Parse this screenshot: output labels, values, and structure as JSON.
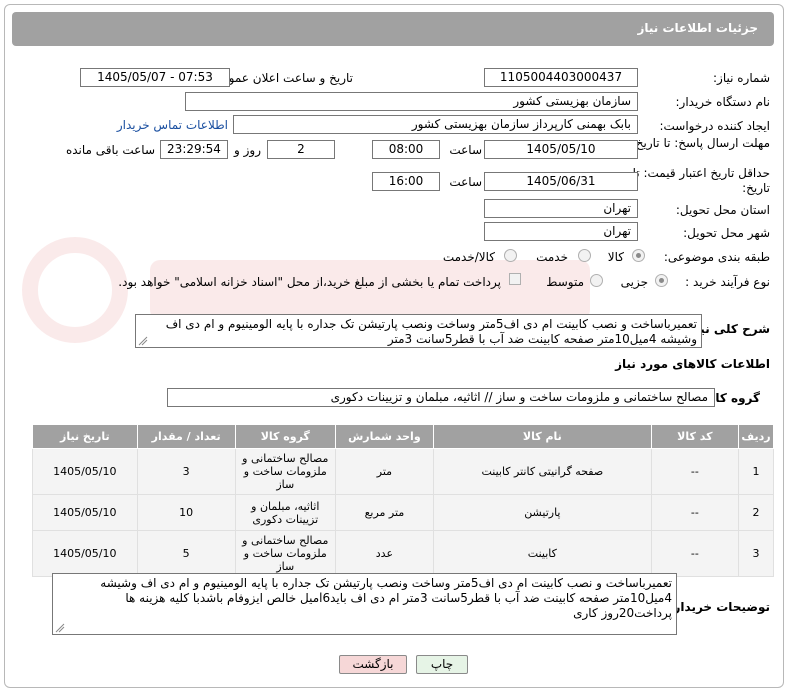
{
  "header": {
    "title": "جزئیات اطلاعات نیاز"
  },
  "fields": {
    "need_number_label": "شماره نیاز:",
    "need_number": "1105004403000437",
    "announce_label": "تاریخ و ساعت اعلان عمومی:",
    "announce_value": "1405/05/07 - 07:53",
    "buyer_org_label": "نام دستگاه خریدار:",
    "buyer_org": "سازمان بهزیستی کشور",
    "creator_label": "ایجاد کننده درخواست:",
    "creator": "بابک بهمنی کارپرداز سازمان بهزیستی کشور",
    "contact_link": "اطلاعات تماس خریدار",
    "send_deadline_label": "مهلت ارسال پاسخ: تا تاریخ:",
    "send_date": "1405/05/10",
    "time_label": "ساعت",
    "send_time": "08:00",
    "days": "2",
    "days_label": "روز و",
    "remaining": "23:29:54",
    "remaining_label": "ساعت باقی مانده",
    "price_validity_label": "حداقل تاریخ اعتبار قیمت: تا تاریخ:",
    "validity_date": "1405/06/31",
    "validity_time": "16:00",
    "province_label": "استان محل تحویل:",
    "province": "تهران",
    "city_label": "شهر محل تحویل:",
    "city": "تهران",
    "category_label": "طبقه بندی موضوعی:",
    "category_options": [
      "کالا",
      "خدمت",
      "کالا/خدمت"
    ],
    "process_label": "نوع فرآیند خرید :",
    "process_options": [
      "جزیی",
      "متوسط"
    ],
    "payment_note": "پرداخت تمام یا بخشی از مبلغ خرید،از محل \"اسناد خزانه اسلامی\" خواهد بود."
  },
  "description": {
    "label": "شرح کلی نیاز:",
    "text": "تعمیرباساخت و نصب کابینت ام دی اف5متر وساخت ونصب پارتیشن تک جداره با پایه الومینیوم و ام دی اف وشیشه 4میل10متر صفحه کابینت ضد آب با قطر5سانت 3متر"
  },
  "goods_section": {
    "title": "اطلاعات کالاهای مورد نیاز",
    "group_label": "گروه کالا:",
    "group_value": "مصالح ساختمانی و ملزومات ساخت و ساز // اثاثیه، مبلمان و تزیینات دکوری"
  },
  "table": {
    "headers": [
      "ردیف",
      "کد کالا",
      "نام کالا",
      "واحد شمارش",
      "گروه کالا",
      "تعداد / مقدار",
      "تاریخ نیاز"
    ],
    "rows": [
      [
        "1",
        "--",
        "صفحه گرانیتی کانتر کابینت",
        "متر",
        "مصالح ساختمانی و ملزومات ساخت و ساز",
        "3",
        "1405/05/10"
      ],
      [
        "2",
        "--",
        "پارتیشن",
        "متر مربع",
        "اثاثیه، مبلمان و تزیینات دکوری",
        "10",
        "1405/05/10"
      ],
      [
        "3",
        "--",
        "کابینت",
        "عدد",
        "مصالح ساختمانی و ملزومات ساخت و ساز",
        "5",
        "1405/05/10"
      ]
    ]
  },
  "buyer_notes": {
    "label": "توضیحات خریدار:",
    "text": "تعمیرباساخت و نصب کابینت ام دی اف5متر وساخت ونصب پارتیشن تک جداره با پایه الومینیوم و ام دی اف وشیشه 4میل10متر صفحه کابینت ضد آب با قطر5سانت 3متر ام دی اف بایدl6میل خالص ایزوفام باشدبا کلیه هزینه ها پرداخت20روز کاری"
  },
  "buttons": {
    "print": "چاپ",
    "back": "بازگشت"
  },
  "colors": {
    "header": "#a1a1a1",
    "link": "#1a4fa0",
    "back_button": "#f6d7d7",
    "print_button": "#e6f4e6"
  }
}
